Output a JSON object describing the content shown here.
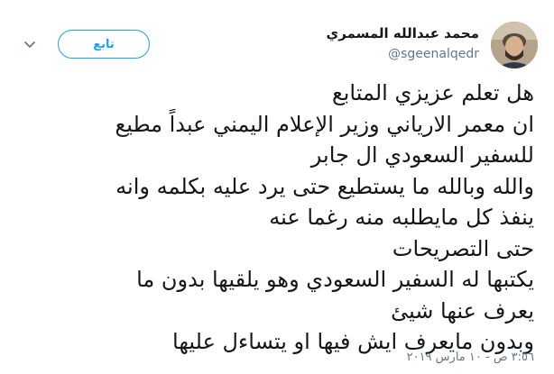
{
  "author": {
    "display_name": "محمد عبدالله المسمري",
    "handle": "@sgeenalqedr"
  },
  "follow_button": {
    "label": "تابع"
  },
  "caret_icon": "chevron-down-icon",
  "tweet": {
    "lines": [
      "هل تعلم عزيزي المتابع",
      "ان معمر الارياني وزير الإعلام اليمني عبداً مطيع",
      "للسفير السعودي ال جابر",
      "والله وبالله ما يستطيع  حتى يرد عليه بكلمه وانه",
      "ينفذ كل مايطلبه منه رغما عنه",
      "حتى التصريحات",
      "يكتبها له السفير السعودي وهو يلقيها بدون ما",
      "يعرف عنها شيئ",
      "وبدون مايعرف ايش فيها او يتساءل عليها"
    ],
    "timestamp": "٣:٥٦ ص - ١٠ مارس ٢٠١٩"
  },
  "colors": {
    "accent": "#1da1f2",
    "text": "#14171a",
    "secondary": "#657786"
  }
}
